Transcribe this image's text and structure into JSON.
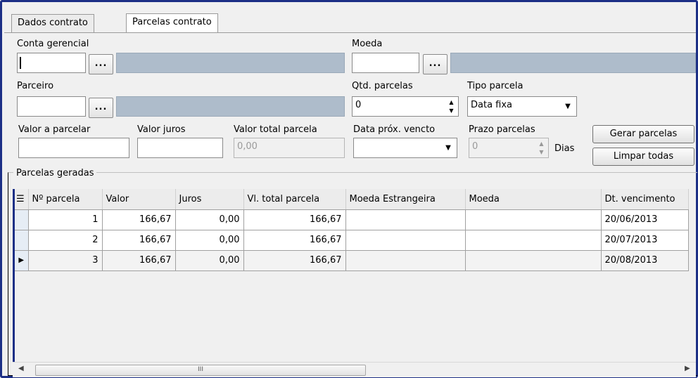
{
  "tabs": [
    {
      "label": "Dados contrato",
      "active": false
    },
    {
      "label": "Parcelas contrato",
      "active": true
    }
  ],
  "form": {
    "conta_gerencial": {
      "label": "Conta gerencial",
      "value": "",
      "browse_label": "..."
    },
    "moeda": {
      "label": "Moeda",
      "value": "",
      "browse_label": "..."
    },
    "parceiro": {
      "label": "Parceiro",
      "value": "",
      "browse_label": "..."
    },
    "qtd_parcelas": {
      "label": "Qtd. parcelas",
      "value": "0"
    },
    "tipo_parcela": {
      "label": "Tipo parcela",
      "value": "Data fixa"
    },
    "valor_a_parcelar": {
      "label": "Valor a parcelar",
      "value": ""
    },
    "valor_juros": {
      "label": "Valor juros",
      "value": ""
    },
    "valor_total_parcela": {
      "label": "Valor total parcela",
      "value": "0,00"
    },
    "data_prox_vencto": {
      "label": "Data próx. vencto",
      "value": ""
    },
    "prazo_parcelas": {
      "label": "Prazo parcelas",
      "value": "0",
      "unit": "Dias"
    }
  },
  "buttons": {
    "gerar": "Gerar parcelas",
    "limpar": "Limpar todas"
  },
  "group": {
    "title": "Parcelas geradas"
  },
  "grid": {
    "columns": [
      "Nº parcela",
      "Valor",
      "Juros",
      "Vl. total parcela",
      "Moeda Estrangeira",
      "Moeda",
      "Dt. vencimento"
    ],
    "rows": [
      {
        "n": "1",
        "valor": "166,67",
        "juros": "0,00",
        "total": "166,67",
        "moeda_estr": "",
        "moeda": "",
        "venc": "20/06/2013"
      },
      {
        "n": "2",
        "valor": "166,67",
        "juros": "0,00",
        "total": "166,67",
        "moeda_estr": "",
        "moeda": "",
        "venc": "20/07/2013"
      },
      {
        "n": "3",
        "valor": "166,67",
        "juros": "0,00",
        "total": "166,67",
        "moeda_estr": "",
        "moeda": "",
        "venc": "20/08/2013"
      }
    ]
  },
  "scroll": {
    "thumb_grip": "III"
  },
  "icons": {
    "column-chooser": "column-chooser-icon",
    "row-pointer": "row-pointer-icon",
    "spin-up": "spin-up-icon",
    "spin-down": "spin-down-icon",
    "dropdown": "chevron-down-icon",
    "scroll-left": "scroll-left-icon",
    "scroll-right": "scroll-right-icon"
  },
  "colors": {
    "frame": "#1c2f86",
    "readonly_field": "#aebccb",
    "panel": "#f0f0f0"
  }
}
